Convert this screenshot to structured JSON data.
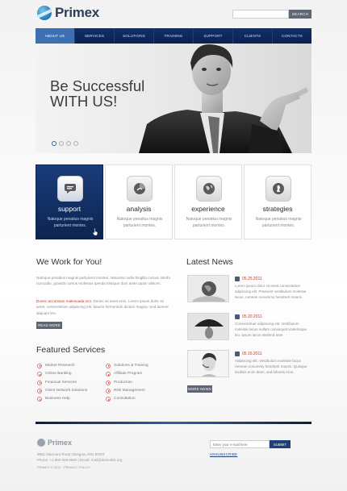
{
  "brand": {
    "name": "Primex"
  },
  "search": {
    "placeholder": "",
    "button": "SEARCH"
  },
  "nav": {
    "items": [
      "ABOUT US",
      "SERVICES",
      "SOLUTIONS",
      "TRAINING",
      "SUPPORT",
      "CLIENTS",
      "CONTACTS"
    ],
    "active": 0
  },
  "hero": {
    "line1": "Be Successful",
    "line2": "WITH US!",
    "slides": 4,
    "active_slide": 0
  },
  "services": [
    {
      "title": "support",
      "text": "Natoque penatius magnis parturient montes.",
      "icon": "chat-icon",
      "active": true
    },
    {
      "title": "analysis",
      "text": "Natoque penatius magnis parturient montes.",
      "icon": "pie-chart-icon",
      "active": false
    },
    {
      "title": "experience",
      "text": "Natoque penatius magnis parturient montes.",
      "icon": "globe-icon",
      "active": false
    },
    {
      "title": "strategies",
      "text": "Natoque penatius magnis parturient montes.",
      "icon": "chess-icon",
      "active": false
    }
  ],
  "work": {
    "title": "We Work for You!",
    "p1": "Natoque penatius magnis parturient montes. Nascetur nulla fringilla cursus. Morbi nuncodio, gravida cursus molestus ipenda tristique dum amet quam ultrices.",
    "p2_red": "Donec accumsan malesuada orci.",
    "p2": " Donec sit amet eros. Lorem ipsum dolor sit amet, consectetuer adipiscing elit. Mauris fermentum dictum magna. Sed laoreet aliquam leo.",
    "button": "READ MORE"
  },
  "featured": {
    "title": "Featured Services",
    "col1": [
      "Market Research",
      "Online Banking",
      "Financial Services",
      "Client Network Solutions",
      "Business Help"
    ],
    "col2": [
      "Solutions & Training",
      "Affiliate Program",
      "Production",
      "Risk Management",
      "Consultation"
    ]
  },
  "news": {
    "title": "Latest News",
    "items": [
      {
        "date": "05.25.2011",
        "text": "Lorem ipsum dolor sit amet consectetuer adipiscing elit. Praesent vestibulum molestie lacus. Aenean nonummy hendrerit mauris."
      },
      {
        "date": "05.20.2011",
        "text": "Consectetuer adipiscing elit. Vestibulum molestie lacus nullam consequat scelerisque leo, ipsum lacus eleifend ante."
      },
      {
        "date": "05.15.2011",
        "text": "Adipiscing elit. Vestibulum molestie lacus Aenean nonummy hendrerit mauris. Quisque facilisis enim diam, sed lobortis eros."
      }
    ],
    "button": "MORE NEWS"
  },
  "footer": {
    "brand": "Primex",
    "address": "9901 Marmora Road Glasgow, D04 89GR",
    "phone": "Phone: +1 800 559 6580 | Email: mail@demolink.org",
    "copy": "PRIMEX © 2012 · PRIVACY POLICY",
    "newsletter_placeholder": "Enter your e-mail here",
    "subscribe": "SUBMIT",
    "unsubscribe": "UNSUBSCRIBE"
  },
  "colors": {
    "nav": "#0c2655",
    "accent_red": "#c23b22",
    "active_nav": "#3d70b0"
  }
}
